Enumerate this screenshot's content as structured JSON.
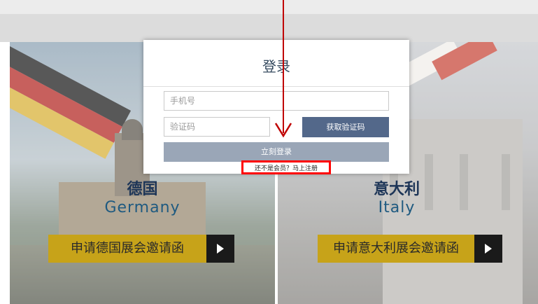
{
  "modal": {
    "title": "登录",
    "phone_placeholder": "手机号",
    "code_placeholder": "验证码",
    "get_code_label": "获取验证码",
    "login_label": "立刻登录",
    "register_link": "还不是会员？马上注册"
  },
  "panels": [
    {
      "country_cn": "德国",
      "country_en": "Germany",
      "apply_label": "申请德国展会邀请函"
    },
    {
      "country_cn": "意大利",
      "country_en": "Italy",
      "apply_label": "申请意大利展会邀请函"
    }
  ],
  "colors": {
    "annotation": "#ff0000",
    "accent_button": "#53688a",
    "apply_gold": "#c7a319"
  },
  "icons": {
    "play": "play-triangle-icon"
  }
}
